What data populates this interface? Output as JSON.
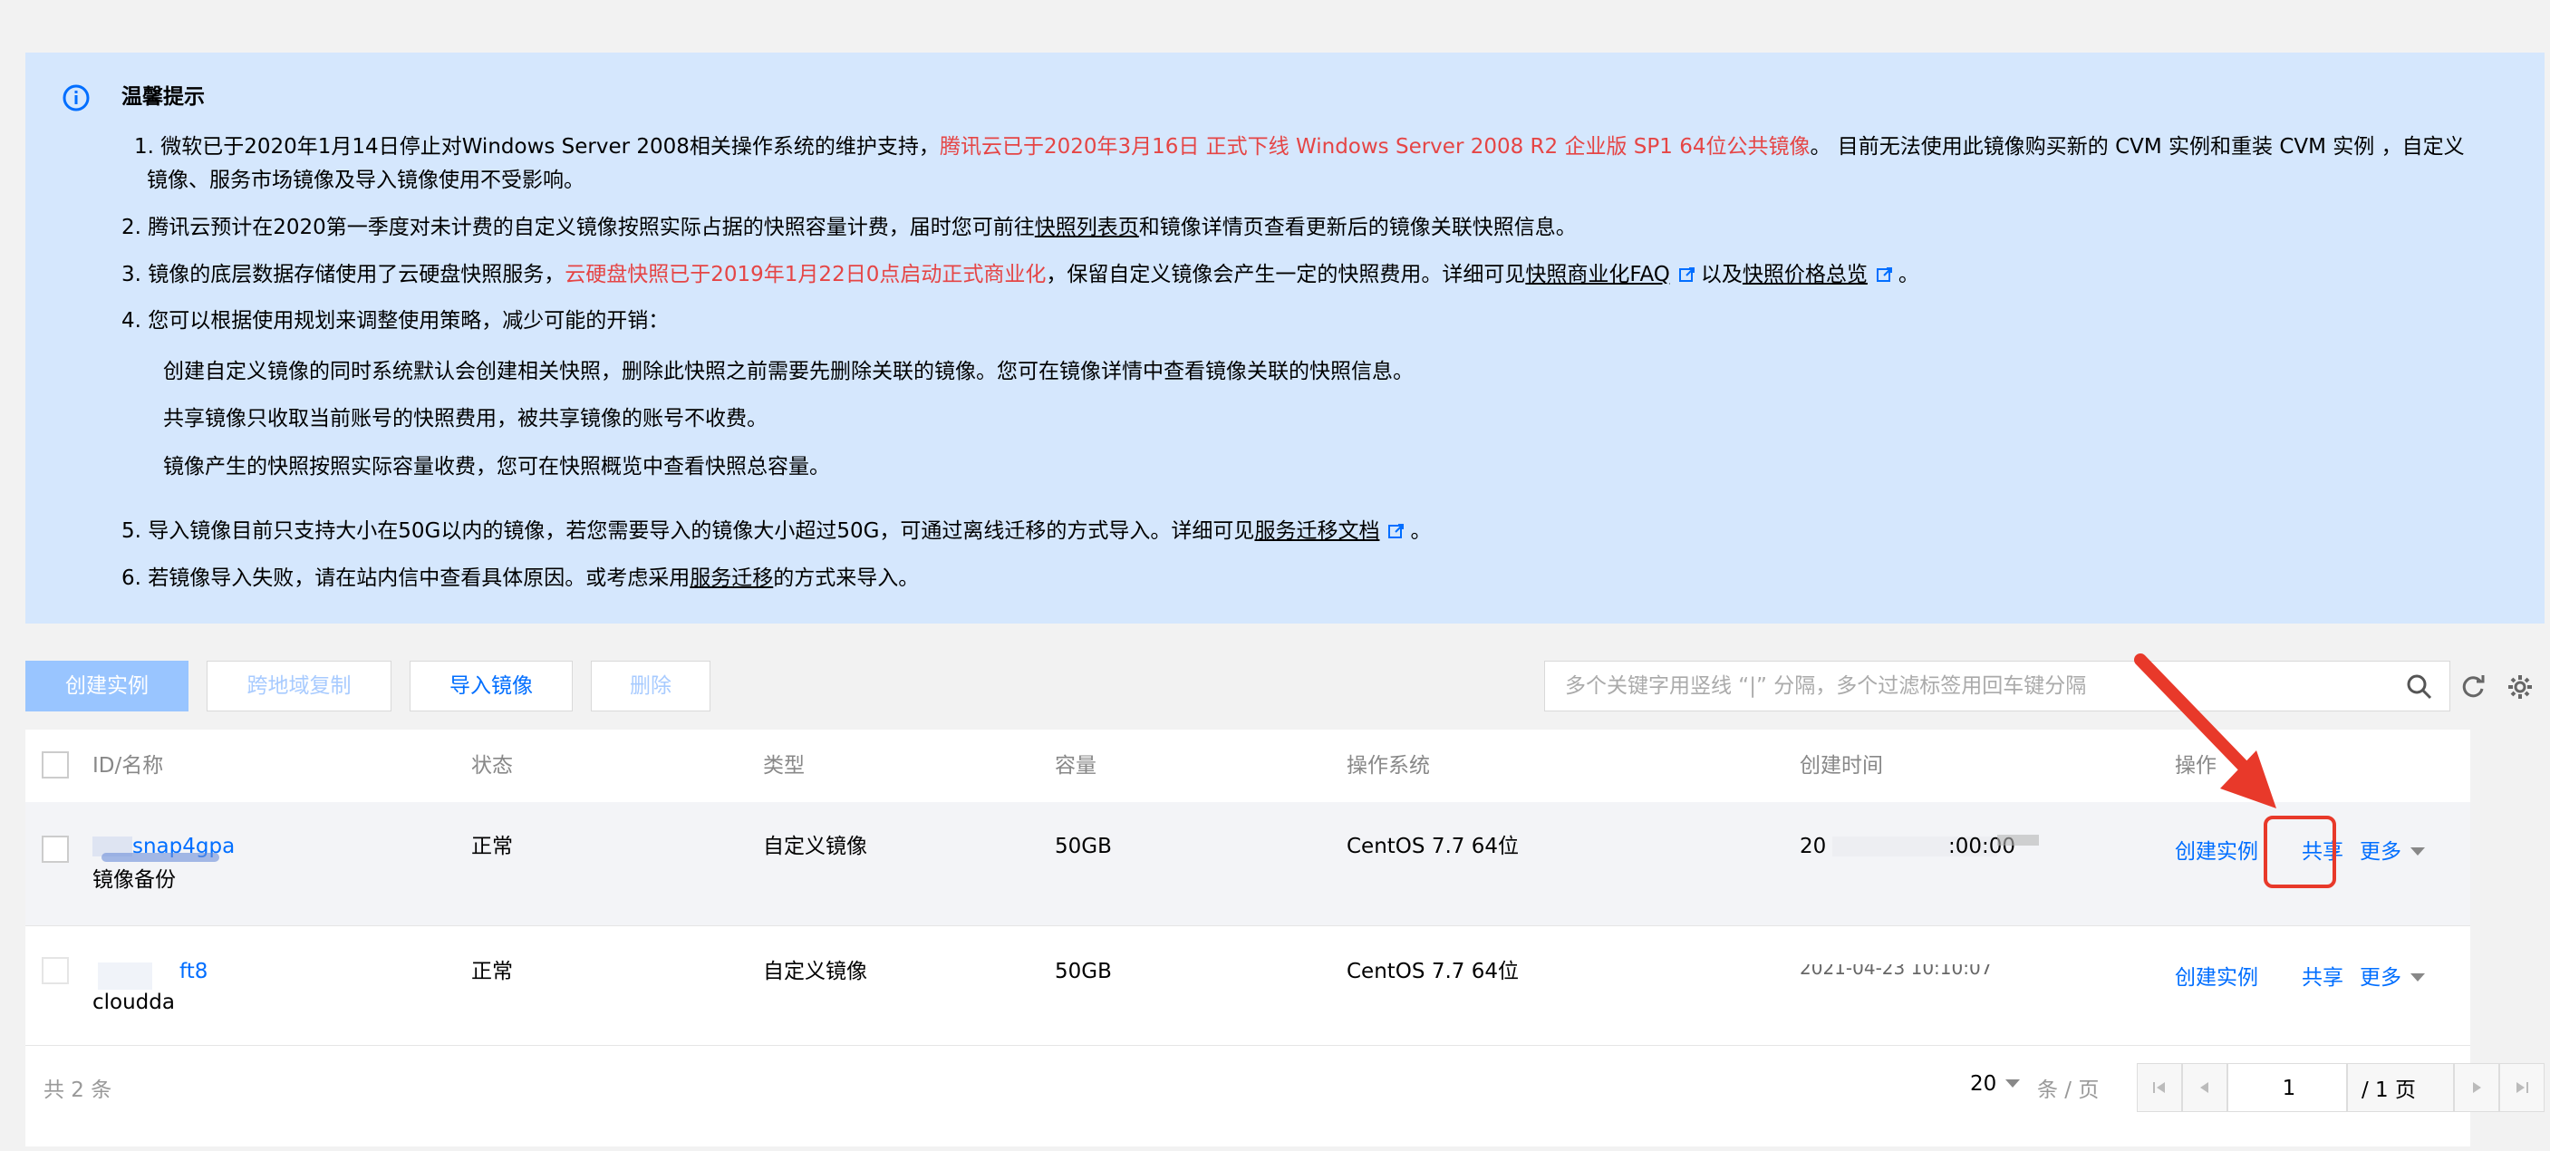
{
  "notice": {
    "title": "温馨提示",
    "item1_pre": "1. 微软已于2020年1月14日停止对Windows Server 2008相关操作系统的维护支持，",
    "item1_red": "腾讯云已于2020年3月16日 正式下线 Windows Server 2008 R2 企业版 SP1 64位公共镜像",
    "item1_post": "。 目前无法使用此镜像购买新的 CVM 实例和重装 CVM 实例 ，自定义",
    "item1_line2": "镜像、服务市场镜像及导入镜像使用不受影响。",
    "item2_pre": "2. 腾讯云预计在2020第一季度对未计费的自定义镜像按照实际占据的快照容量计费，届时您可前往",
    "item2_link": "快照列表页",
    "item2_post": "和镜像详情页查看更新后的镜像关联快照信息。",
    "item3_pre": "3. 镜像的底层数据存储使用了云硬盘快照服务，",
    "item3_red": "云硬盘快照已于2019年1月22日0点启动正式商业化",
    "item3_mid": "，保留自定义镜像会产生一定的快照费用。详细可见",
    "item3_link1": "快照商业化FAQ",
    "item3_and": "以及",
    "item3_link2": "快照价格总览",
    "item3_end": "。",
    "item4": "4. 您可以根据使用规划来调整使用策略，减少可能的开销：",
    "bullets": [
      "创建自定义镜像的同时系统默认会创建相关快照，删除此快照之前需要先删除关联的镜像。您可在镜像详情中查看镜像关联的快照信息。",
      "共享镜像只收取当前账号的快照费用，被共享镜像的账号不收费。",
      "镜像产生的快照按照实际容量收费，您可在快照概览中查看快照总容量。"
    ],
    "item5_pre": "5. 导入镜像目前只支持大小在50G以内的镜像，若您需要导入的镜像大小超过50G，可通过离线迁移的方式导入。详细可见",
    "item5_link": "服务迁移文档",
    "item5_end": "。",
    "item6_pre": "6. 若镜像导入失败，请在站内信中查看具体原因。或考虑采用",
    "item6_link": "服务迁移",
    "item6_post": "的方式来导入。"
  },
  "toolbar": {
    "create_instance": "创建实例",
    "cross_region_copy": "跨地域复制",
    "import_image": "导入镜像",
    "delete": "删除",
    "search_placeholder": "多个关键字用竖线 “|” 分隔，多个过滤标签用回车键分隔"
  },
  "table": {
    "headers": {
      "id_name": "ID/名称",
      "status": "状态",
      "type": "类型",
      "capacity": "容量",
      "os": "操作系统",
      "created": "创建时间",
      "ops": "操作"
    },
    "rows": [
      {
        "id": "snap4gpa",
        "name": "镜像备份",
        "status": "正常",
        "type": "自定义镜像",
        "capacity": "50GB",
        "os": "CentOS 7.7 64位",
        "created_visible_start": "20",
        "created_visible_end": ":00:00",
        "ops": [
          "创建实例",
          "共享",
          "更多"
        ]
      },
      {
        "id": "ft8",
        "name": "cloudda",
        "status": "正常",
        "type": "自定义镜像",
        "capacity": "50GB",
        "os": "CentOS 7.7 64位",
        "created_visible": "2021-04-23 10:10:07",
        "ops": [
          "创建实例",
          "共享",
          "更多"
        ]
      }
    ]
  },
  "footer": {
    "total": "共 2 条",
    "page_size": "20",
    "per_page_label": "条 / 页",
    "current_page": "1",
    "total_pages": "/ 1 页"
  },
  "colors": {
    "link": "#006eff",
    "notice_bg": "#d5e7fd",
    "warning_red": "#e54545",
    "annotation_red": "#e8392a"
  }
}
